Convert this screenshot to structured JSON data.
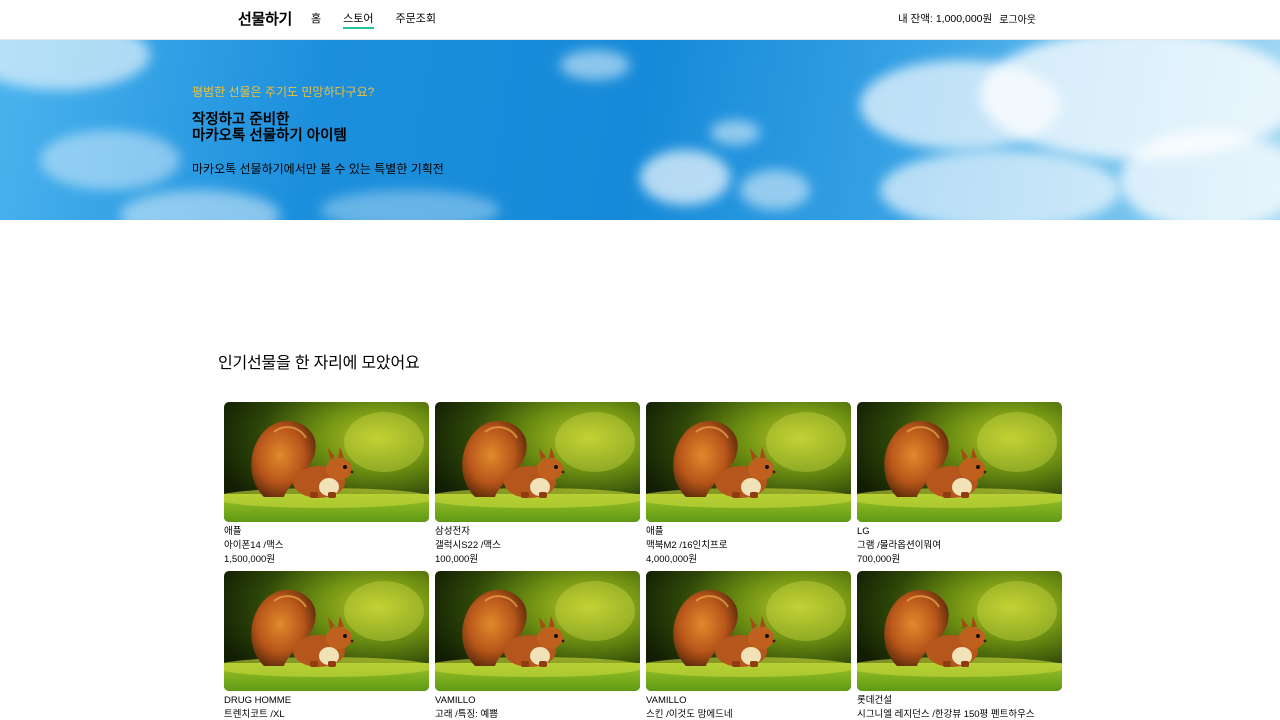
{
  "header": {
    "logo": "선물하기",
    "nav": [
      {
        "label": "홈",
        "active": false
      },
      {
        "label": "스토어",
        "active": true
      },
      {
        "label": "주문조회",
        "active": false
      }
    ],
    "balance_label": "내 잔액:",
    "balance_value": "1,000,000원",
    "logout_label": "로그아웃"
  },
  "banner": {
    "eyebrow": "평범한 선물은 주기도 민망하다구요?",
    "title_line1": "작정하고 준비한",
    "title_line2": "마카오톡 선물하기 아이템",
    "subtitle": "마카오톡 선물하기에서만 볼 수 있는 특별한 기획전"
  },
  "section": {
    "title": "인기선물을 한 자리에 모았어요"
  },
  "products": [
    {
      "brand": "애플",
      "name": "아이폰14 /맥스",
      "price": "1,500,000원"
    },
    {
      "brand": "삼성전자",
      "name": "갤럭시S22 /맥스",
      "price": "100,000원"
    },
    {
      "brand": "애플",
      "name": "맥북M2 /16인치프로",
      "price": "4,000,000원"
    },
    {
      "brand": "LG",
      "name": "그램 /몰라옵션이뭐여",
      "price": "700,000원"
    },
    {
      "brand": "DRUG HOMME",
      "name": "트렌치코트 /XL",
      "price": ""
    },
    {
      "brand": "VAMILLO",
      "name": "고래 /특징: 예쁨",
      "price": ""
    },
    {
      "brand": "VAMILLO",
      "name": "스킨 /이것도 맘에드네",
      "price": ""
    },
    {
      "brand": "롯데건설",
      "name": "시그니엘 레지던스 /한강뷰 150평 펜트하우스",
      "price": ""
    }
  ],
  "colors": {
    "accent": "#20c39b",
    "eyebrow": "#f2c036"
  }
}
